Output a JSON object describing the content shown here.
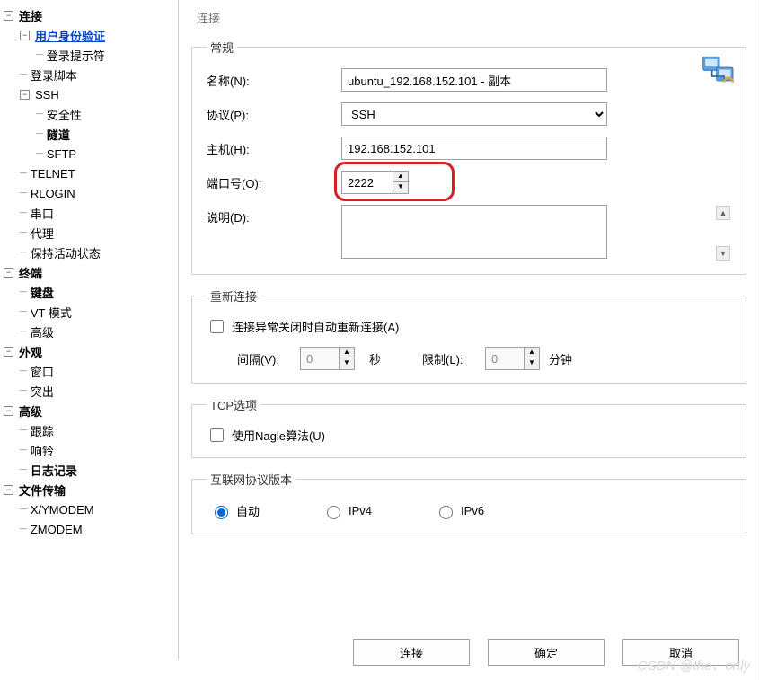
{
  "sidebar": {
    "nodes": [
      {
        "depth": 0,
        "toggle": "-",
        "bold": true,
        "label": "连接"
      },
      {
        "depth": 1,
        "toggle": "-",
        "link": true,
        "bold": true,
        "label": "用户身份验证"
      },
      {
        "depth": 2,
        "label": "登录提示符"
      },
      {
        "depth": 1,
        "label": "登录脚本"
      },
      {
        "depth": 1,
        "toggle": "-",
        "label": "SSH"
      },
      {
        "depth": 2,
        "label": "安全性"
      },
      {
        "depth": 2,
        "bold": true,
        "label": "隧道"
      },
      {
        "depth": 2,
        "label": "SFTP"
      },
      {
        "depth": 1,
        "label": "TELNET"
      },
      {
        "depth": 1,
        "label": "RLOGIN"
      },
      {
        "depth": 1,
        "label": "串口"
      },
      {
        "depth": 1,
        "label": "代理"
      },
      {
        "depth": 1,
        "label": "保持活动状态"
      },
      {
        "depth": 0,
        "toggle": "-",
        "bold": true,
        "label": "终端"
      },
      {
        "depth": 1,
        "bold": true,
        "label": "键盘"
      },
      {
        "depth": 1,
        "label": "VT 模式"
      },
      {
        "depth": 1,
        "label": "高级"
      },
      {
        "depth": 0,
        "toggle": "-",
        "bold": true,
        "label": "外观"
      },
      {
        "depth": 1,
        "label": "窗口"
      },
      {
        "depth": 1,
        "label": "突出"
      },
      {
        "depth": 0,
        "toggle": "-",
        "bold": true,
        "label": "高级"
      },
      {
        "depth": 1,
        "label": "跟踪"
      },
      {
        "depth": 1,
        "label": "响铃"
      },
      {
        "depth": 1,
        "bold": true,
        "label": "日志记录"
      },
      {
        "depth": 0,
        "toggle": "-",
        "bold": true,
        "label": "文件传输"
      },
      {
        "depth": 1,
        "label": "X/YMODEM"
      },
      {
        "depth": 1,
        "label": "ZMODEM"
      }
    ]
  },
  "page_title": "连接",
  "groups": {
    "general": {
      "legend": "常规",
      "name_label": "名称(N):",
      "name_value": "ubuntu_192.168.152.101 - 副本",
      "proto_label": "协议(P):",
      "proto_value": "SSH",
      "host_label": "主机(H):",
      "host_value": "192.168.152.101",
      "port_label": "端口号(O):",
      "port_value": "2222",
      "desc_label": "说明(D):",
      "desc_value": ""
    },
    "reconnect": {
      "legend": "重新连接",
      "chk_label": "连接异常关闭时自动重新连接(A)",
      "interval_label": "间隔(V):",
      "interval_value": "0",
      "interval_unit": "秒",
      "limit_label": "限制(L):",
      "limit_value": "0",
      "limit_unit": "分钟"
    },
    "tcp": {
      "legend": "TCP选项",
      "nagle_label": "使用Nagle算法(U)"
    },
    "ipver": {
      "legend": "互联网协议版本",
      "auto": "自动",
      "v4": "IPv4",
      "v6": "IPv6"
    }
  },
  "buttons": {
    "connect": "连接",
    "ok": "确定",
    "cancel": "取消"
  },
  "watermark": "CSDN @the、only"
}
